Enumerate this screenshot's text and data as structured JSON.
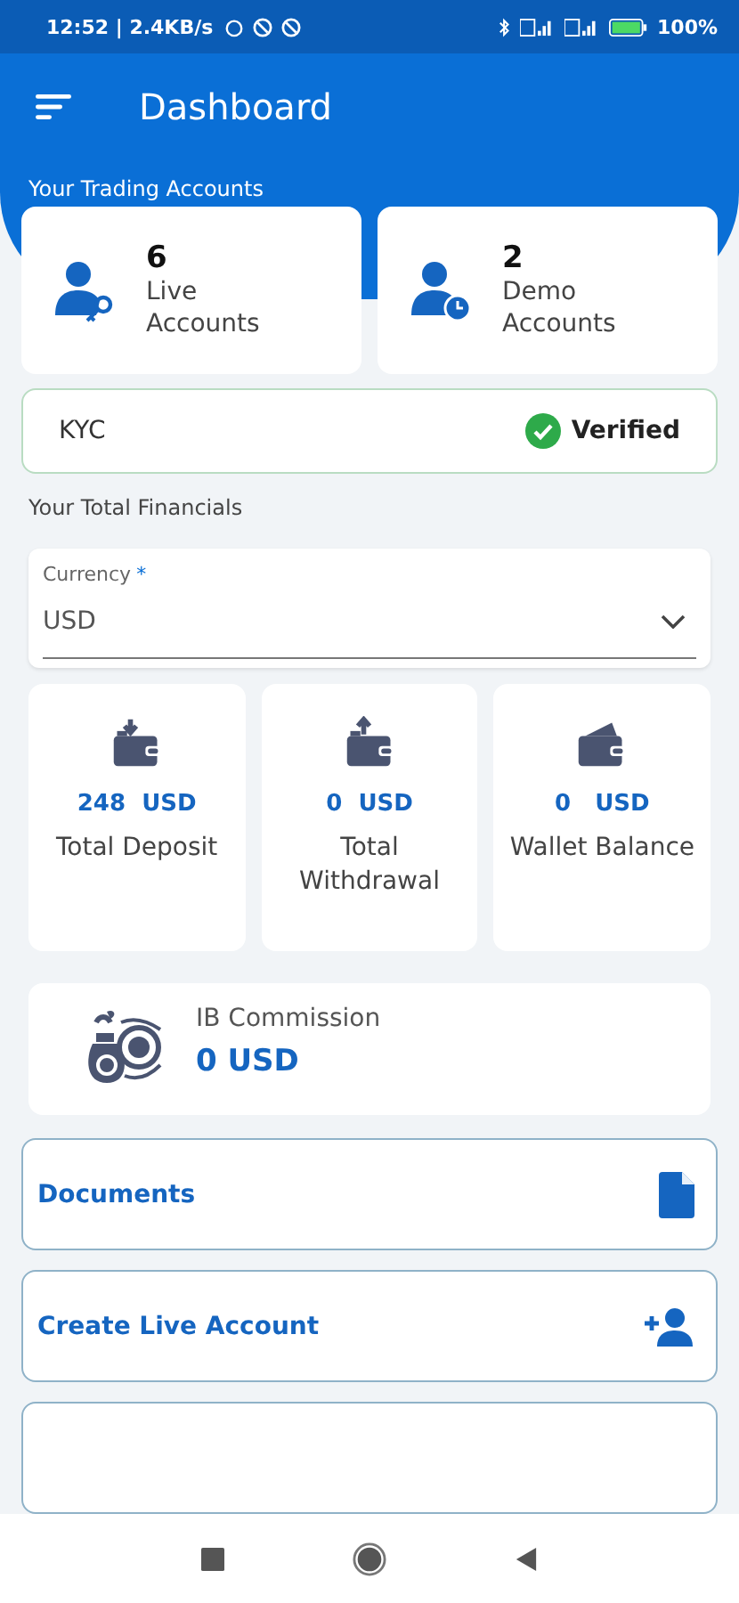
{
  "status_bar": {
    "time": "12:52 | 2.4KB/s",
    "battery": "100%"
  },
  "app_bar": {
    "title": "Dashboard"
  },
  "trading_accounts": {
    "heading": "Your Trading Accounts",
    "cards": [
      {
        "kind": "live",
        "count": "6",
        "label": "Live Accounts"
      },
      {
        "kind": "demo",
        "count": "2",
        "label": "Demo Accounts"
      }
    ]
  },
  "kyc": {
    "label": "KYC",
    "status": "Verified",
    "verified": true
  },
  "financials": {
    "heading": "Your Total Financials",
    "currency": {
      "label": "Currency",
      "required_mark": "*",
      "value": "USD"
    },
    "stats": [
      {
        "kind": "deposit",
        "amount": "248  USD",
        "label": "Total Deposit"
      },
      {
        "kind": "withdrawal",
        "amount": "0  USD",
        "label": "Total Withdrawal"
      },
      {
        "kind": "wallet",
        "amount": "0   USD",
        "label": "Wallet Balance"
      }
    ],
    "ib_commission": {
      "label": "IB Commission",
      "amount": "0 USD"
    }
  },
  "menu": [
    {
      "kind": "documents",
      "label": "Documents"
    },
    {
      "kind": "create_account",
      "label": "Create Live Account"
    }
  ]
}
